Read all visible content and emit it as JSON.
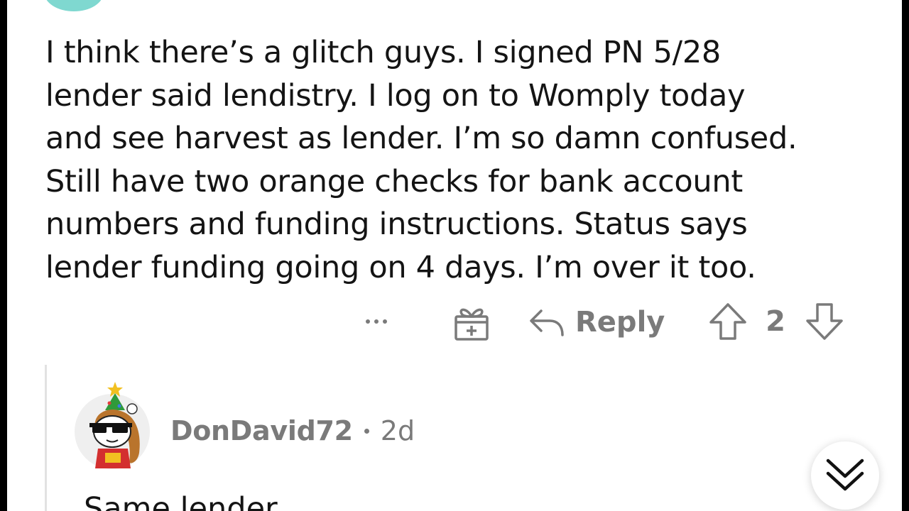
{
  "comment": {
    "lines": [
      "I think there’s a glitch guys. I signed PN 5/28",
      "lender said lendistry. I log on to Womply today",
      "and see harvest as lender. I’m so damn confused.",
      "Still have two orange checks for bank account",
      "numbers and funding instructions. Status says",
      "lender funding going on 4 days. I’m over it too."
    ]
  },
  "actions": {
    "more_icon": "more-horizontal-icon",
    "award_icon": "gift-icon",
    "reply_label": "Reply",
    "reply_icon": "reply-arrow-icon",
    "upvote_icon": "arrow-up-icon",
    "vote_count": "2",
    "downvote_icon": "arrow-down-icon"
  },
  "reply": {
    "username": "DonDavid72",
    "time": "2d",
    "body": "Same lender"
  },
  "scroll_button": {
    "icon": "double-chevron-down-icon"
  },
  "colors": {
    "text": "#141414",
    "muted": "#7a7a7a",
    "avatar_teal": "#7fd8d0",
    "thread_line": "#e2e2e2"
  }
}
